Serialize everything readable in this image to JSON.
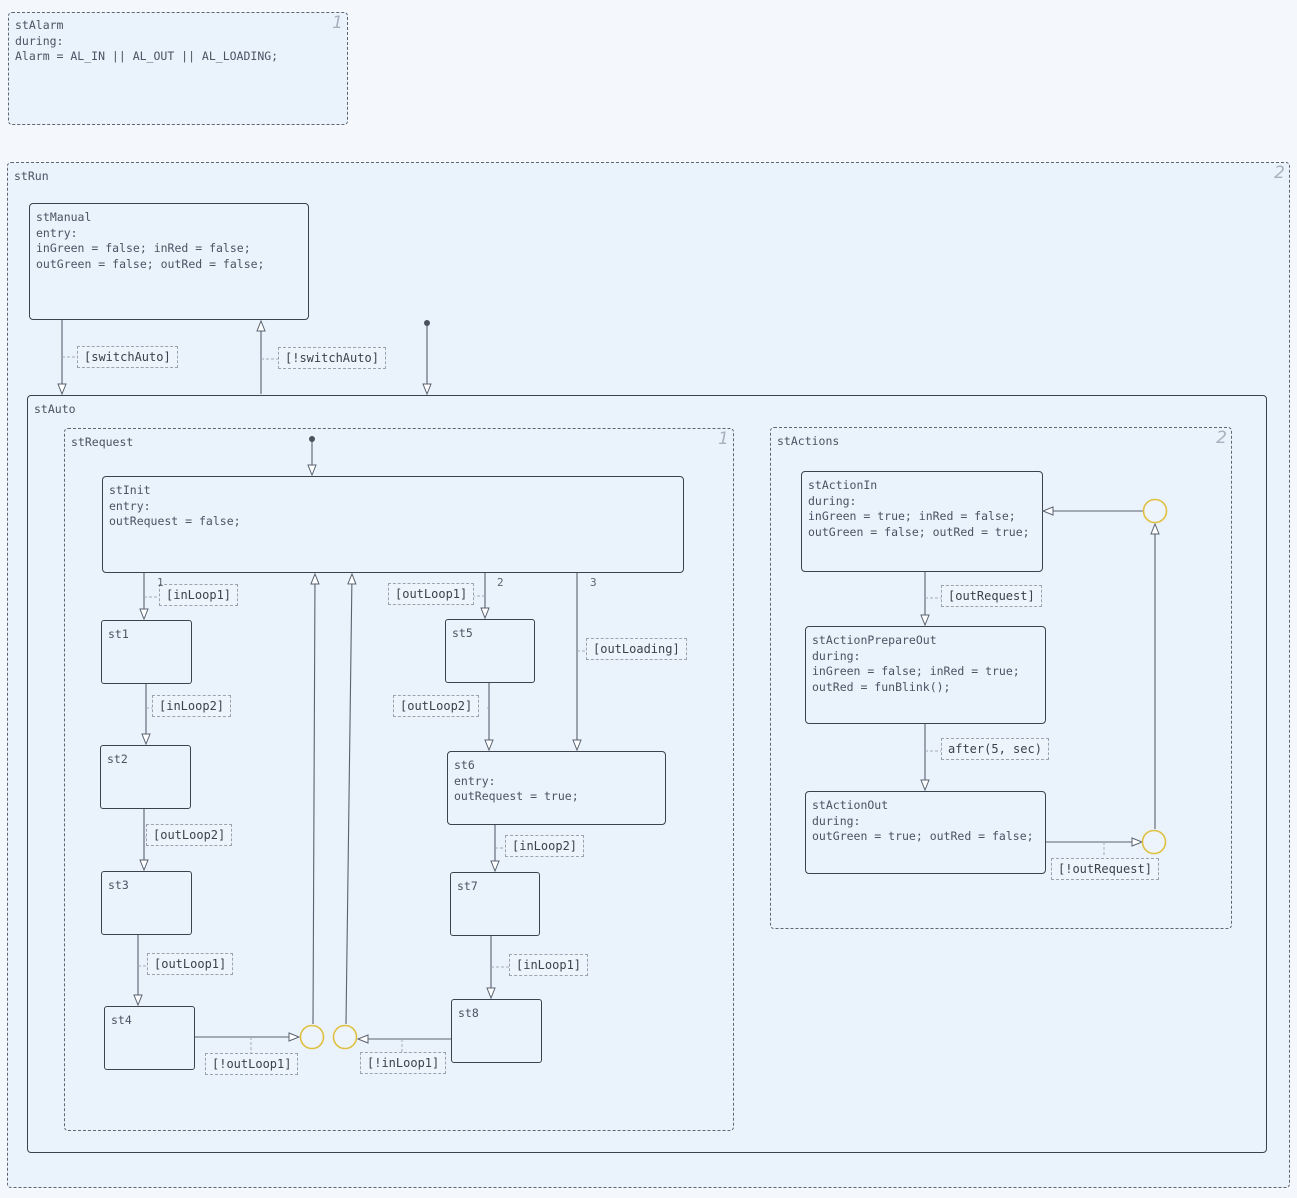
{
  "states": {
    "stAlarm": {
      "text": "stAlarm\nduring:\nAlarm = AL_IN || AL_OUT || AL_LOADING;",
      "order": "1"
    },
    "stRun": {
      "text": "stRun",
      "order": "2"
    },
    "stManual": {
      "text": "stManual\nentry:\ninGreen = false; inRed = false;\noutGreen = false; outRed = false;"
    },
    "stAuto": {
      "text": "stAuto"
    },
    "stRequest": {
      "text": "stRequest",
      "order": "1"
    },
    "stActions": {
      "text": "stActions",
      "order": "2"
    },
    "stInit": {
      "text": "stInit\nentry:\noutRequest = false;"
    },
    "st1": {
      "text": "st1"
    },
    "st2": {
      "text": "st2"
    },
    "st3": {
      "text": "st3"
    },
    "st4": {
      "text": "st4"
    },
    "st5": {
      "text": "st5"
    },
    "st6": {
      "text": "st6\nentry:\noutRequest = true;"
    },
    "st7": {
      "text": "st7"
    },
    "st8": {
      "text": "st8"
    },
    "stActionIn": {
      "text": "stActionIn\nduring:\ninGreen = true; inRed = false;\noutGreen = false; outRed = true;"
    },
    "stActionPrepareOut": {
      "text": "stActionPrepareOut\nduring:\ninGreen = false; inRed = true;\noutRed = funBlink();"
    },
    "stActionOut": {
      "text": "stActionOut\nduring:\noutGreen = true; outRed = false;"
    }
  },
  "transitions": {
    "switchAuto": "[switchAuto]",
    "notSwitchAuto": "[!switchAuto]",
    "inLoop1": "[inLoop1]",
    "inLoop2": "[inLoop2]",
    "outLoop2": "[outLoop2]",
    "outLoop1": "[outLoop1]",
    "notOutLoop1": "[!outLoop1]",
    "notInLoop1": "[!inLoop1]",
    "outLoop1b": "[outLoop1]",
    "outLoop2b": "[outLoop2]",
    "outLoading": "[outLoading]",
    "inLoop2b": "[inLoop2]",
    "inLoop1b": "[inLoop1]",
    "outRequest": "[outRequest]",
    "after": "after(5, sec)",
    "notOutRequest": "[!outRequest]"
  },
  "priorities": {
    "p1": "1",
    "p2": "2",
    "p3": "3"
  },
  "colors": {
    "junction": "#e0c040",
    "line": "#5a6270",
    "container_bg": "#eaf2fc"
  }
}
